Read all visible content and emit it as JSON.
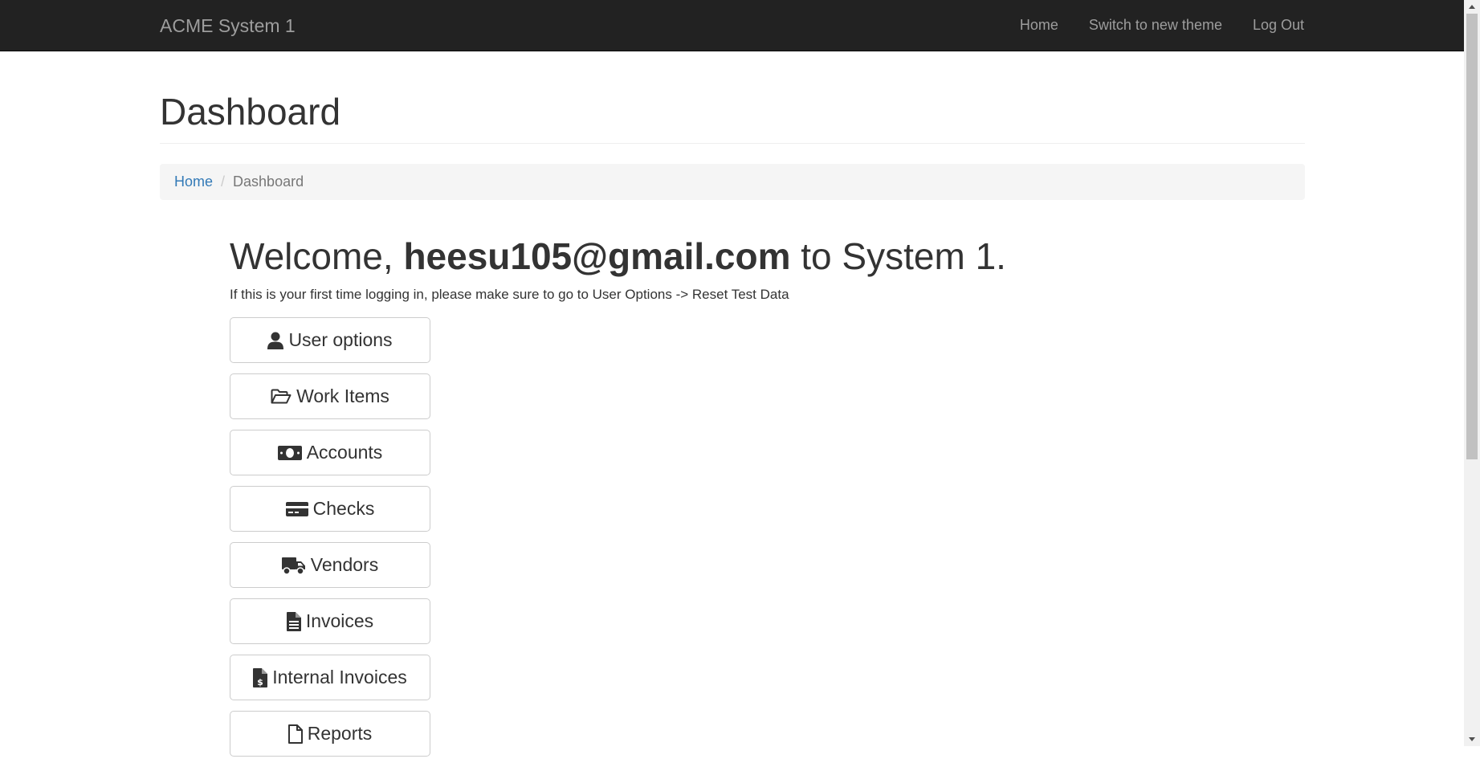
{
  "navbar": {
    "brand": "ACME System 1",
    "links": [
      "Home",
      "Switch to new theme",
      "Log Out"
    ]
  },
  "page": {
    "title": "Dashboard",
    "breadcrumb": {
      "home": "Home",
      "separator": "/",
      "current": "Dashboard"
    }
  },
  "welcome": {
    "prefix": "Welcome,",
    "user": "heesu105@gmail.com",
    "suffix": "to System 1.",
    "hint": "If this is your first time logging in, please make sure to go to User Options -> Reset Test Data"
  },
  "menu": {
    "items": [
      {
        "label": "User options",
        "icon": "user-icon"
      },
      {
        "label": "Work Items",
        "icon": "folder-open-icon"
      },
      {
        "label": "Accounts",
        "icon": "money-icon"
      },
      {
        "label": "Checks",
        "icon": "credit-card-icon"
      },
      {
        "label": "Vendors",
        "icon": "truck-icon"
      },
      {
        "label": "Invoices",
        "icon": "file-text-icon"
      },
      {
        "label": "Internal Invoices",
        "icon": "file-invoice-dollar-icon"
      },
      {
        "label": "Reports",
        "icon": "file-icon"
      }
    ]
  },
  "colors": {
    "navbar_bg": "#222222",
    "navbar_text": "#9d9d9d",
    "link": "#337ab7",
    "breadcrumb_bg": "#f5f5f5"
  }
}
